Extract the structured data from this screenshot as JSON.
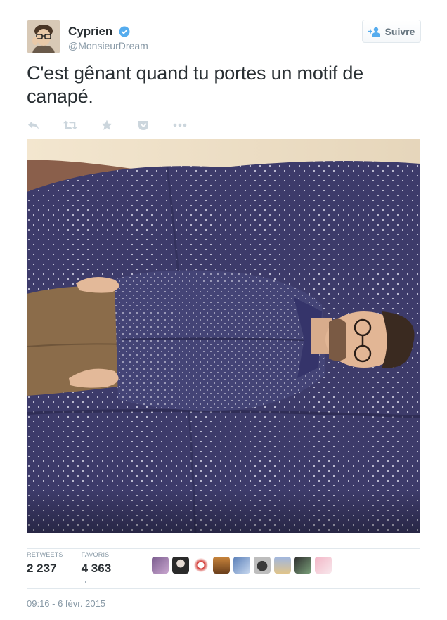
{
  "author": {
    "display_name": "Cyprien",
    "screen_name": "@MonsieurDream",
    "verified": true
  },
  "follow_button": {
    "label": "Suivre",
    "icon": "add-user-icon"
  },
  "tweet": {
    "text": "C'est gênant quand tu portes un motif de canapé."
  },
  "actions": [
    {
      "name": "reply",
      "icon": "reply-icon"
    },
    {
      "name": "retweet",
      "icon": "retweet-icon"
    },
    {
      "name": "favorite",
      "icon": "star-icon"
    },
    {
      "name": "pocket",
      "icon": "pocket-icon"
    },
    {
      "name": "more",
      "icon": "more-icon"
    }
  ],
  "photo": {
    "description_icon": "tweet-photo",
    "colors": {
      "fabric": "#3b3a66",
      "pants": "#8b6c4a",
      "wall": "#efe3cc"
    }
  },
  "stats": {
    "retweets_label": "RETWEETS",
    "retweets_value": "2 237",
    "favorites_label": "FAVORIS",
    "favorites_value": "4 363"
  },
  "favoriters_count_shown": 9,
  "timestamp": "09:16 - 6 févr. 2015",
  "colors": {
    "text": "#292f33",
    "secondary": "#8899a6",
    "verified_blue": "#55acee",
    "border": "#e1e8ed"
  }
}
